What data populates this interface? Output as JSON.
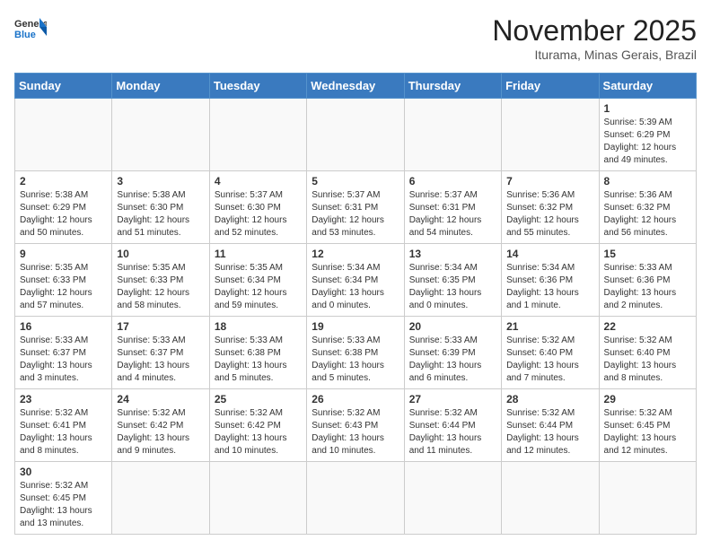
{
  "header": {
    "logo_general": "General",
    "logo_blue": "Blue",
    "month_title": "November 2025",
    "location": "Iturama, Minas Gerais, Brazil"
  },
  "days_of_week": [
    "Sunday",
    "Monday",
    "Tuesday",
    "Wednesday",
    "Thursday",
    "Friday",
    "Saturday"
  ],
  "weeks": [
    [
      {
        "day": "",
        "info": ""
      },
      {
        "day": "",
        "info": ""
      },
      {
        "day": "",
        "info": ""
      },
      {
        "day": "",
        "info": ""
      },
      {
        "day": "",
        "info": ""
      },
      {
        "day": "",
        "info": ""
      },
      {
        "day": "1",
        "info": "Sunrise: 5:39 AM\nSunset: 6:29 PM\nDaylight: 12 hours\nand 49 minutes."
      }
    ],
    [
      {
        "day": "2",
        "info": "Sunrise: 5:38 AM\nSunset: 6:29 PM\nDaylight: 12 hours\nand 50 minutes."
      },
      {
        "day": "3",
        "info": "Sunrise: 5:38 AM\nSunset: 6:30 PM\nDaylight: 12 hours\nand 51 minutes."
      },
      {
        "day": "4",
        "info": "Sunrise: 5:37 AM\nSunset: 6:30 PM\nDaylight: 12 hours\nand 52 minutes."
      },
      {
        "day": "5",
        "info": "Sunrise: 5:37 AM\nSunset: 6:31 PM\nDaylight: 12 hours\nand 53 minutes."
      },
      {
        "day": "6",
        "info": "Sunrise: 5:37 AM\nSunset: 6:31 PM\nDaylight: 12 hours\nand 54 minutes."
      },
      {
        "day": "7",
        "info": "Sunrise: 5:36 AM\nSunset: 6:32 PM\nDaylight: 12 hours\nand 55 minutes."
      },
      {
        "day": "8",
        "info": "Sunrise: 5:36 AM\nSunset: 6:32 PM\nDaylight: 12 hours\nand 56 minutes."
      }
    ],
    [
      {
        "day": "9",
        "info": "Sunrise: 5:35 AM\nSunset: 6:33 PM\nDaylight: 12 hours\nand 57 minutes."
      },
      {
        "day": "10",
        "info": "Sunrise: 5:35 AM\nSunset: 6:33 PM\nDaylight: 12 hours\nand 58 minutes."
      },
      {
        "day": "11",
        "info": "Sunrise: 5:35 AM\nSunset: 6:34 PM\nDaylight: 12 hours\nand 59 minutes."
      },
      {
        "day": "12",
        "info": "Sunrise: 5:34 AM\nSunset: 6:34 PM\nDaylight: 13 hours\nand 0 minutes."
      },
      {
        "day": "13",
        "info": "Sunrise: 5:34 AM\nSunset: 6:35 PM\nDaylight: 13 hours\nand 0 minutes."
      },
      {
        "day": "14",
        "info": "Sunrise: 5:34 AM\nSunset: 6:36 PM\nDaylight: 13 hours\nand 1 minute."
      },
      {
        "day": "15",
        "info": "Sunrise: 5:33 AM\nSunset: 6:36 PM\nDaylight: 13 hours\nand 2 minutes."
      }
    ],
    [
      {
        "day": "16",
        "info": "Sunrise: 5:33 AM\nSunset: 6:37 PM\nDaylight: 13 hours\nand 3 minutes."
      },
      {
        "day": "17",
        "info": "Sunrise: 5:33 AM\nSunset: 6:37 PM\nDaylight: 13 hours\nand 4 minutes."
      },
      {
        "day": "18",
        "info": "Sunrise: 5:33 AM\nSunset: 6:38 PM\nDaylight: 13 hours\nand 5 minutes."
      },
      {
        "day": "19",
        "info": "Sunrise: 5:33 AM\nSunset: 6:38 PM\nDaylight: 13 hours\nand 5 minutes."
      },
      {
        "day": "20",
        "info": "Sunrise: 5:33 AM\nSunset: 6:39 PM\nDaylight: 13 hours\nand 6 minutes."
      },
      {
        "day": "21",
        "info": "Sunrise: 5:32 AM\nSunset: 6:40 PM\nDaylight: 13 hours\nand 7 minutes."
      },
      {
        "day": "22",
        "info": "Sunrise: 5:32 AM\nSunset: 6:40 PM\nDaylight: 13 hours\nand 8 minutes."
      }
    ],
    [
      {
        "day": "23",
        "info": "Sunrise: 5:32 AM\nSunset: 6:41 PM\nDaylight: 13 hours\nand 8 minutes."
      },
      {
        "day": "24",
        "info": "Sunrise: 5:32 AM\nSunset: 6:42 PM\nDaylight: 13 hours\nand 9 minutes."
      },
      {
        "day": "25",
        "info": "Sunrise: 5:32 AM\nSunset: 6:42 PM\nDaylight: 13 hours\nand 10 minutes."
      },
      {
        "day": "26",
        "info": "Sunrise: 5:32 AM\nSunset: 6:43 PM\nDaylight: 13 hours\nand 10 minutes."
      },
      {
        "day": "27",
        "info": "Sunrise: 5:32 AM\nSunset: 6:44 PM\nDaylight: 13 hours\nand 11 minutes."
      },
      {
        "day": "28",
        "info": "Sunrise: 5:32 AM\nSunset: 6:44 PM\nDaylight: 13 hours\nand 12 minutes."
      },
      {
        "day": "29",
        "info": "Sunrise: 5:32 AM\nSunset: 6:45 PM\nDaylight: 13 hours\nand 12 minutes."
      }
    ],
    [
      {
        "day": "30",
        "info": "Sunrise: 5:32 AM\nSunset: 6:45 PM\nDaylight: 13 hours\nand 13 minutes."
      },
      {
        "day": "",
        "info": ""
      },
      {
        "day": "",
        "info": ""
      },
      {
        "day": "",
        "info": ""
      },
      {
        "day": "",
        "info": ""
      },
      {
        "day": "",
        "info": ""
      },
      {
        "day": "",
        "info": ""
      }
    ]
  ]
}
